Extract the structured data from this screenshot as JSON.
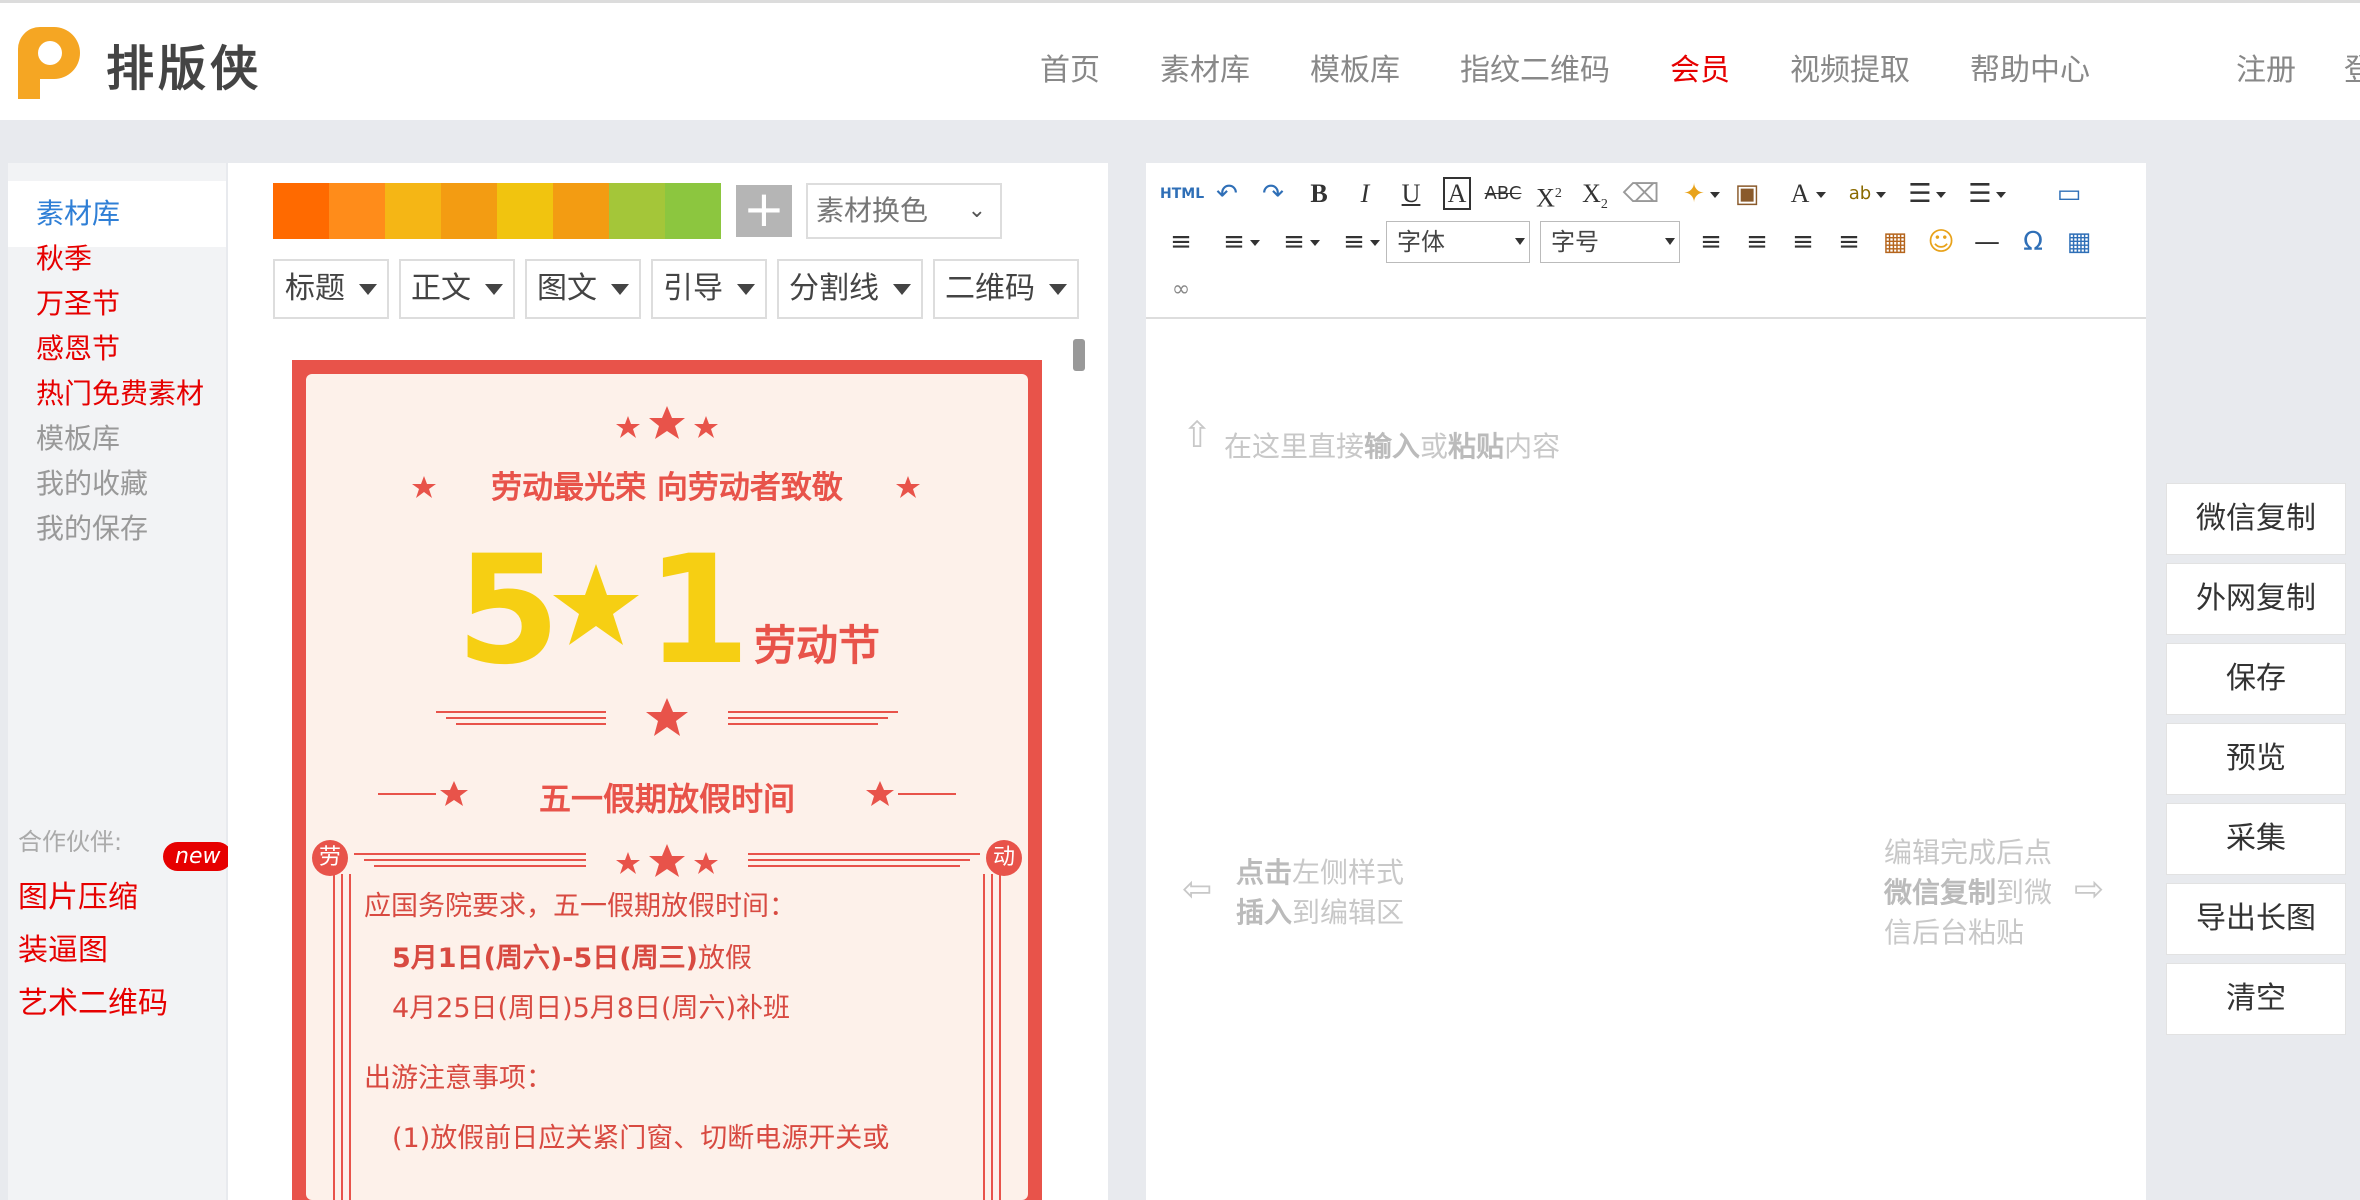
{
  "brand": {
    "name": "排版侠",
    "accent": "#f5a623"
  },
  "nav": {
    "items": [
      "首页",
      "素材库",
      "模板库",
      "指纹二维码",
      "会员",
      "视频提取",
      "帮助中心"
    ],
    "active_index": 4,
    "register": "注册",
    "login_partial": "登"
  },
  "sidebar": {
    "items": [
      {
        "label": "素材库",
        "state": "selected"
      },
      {
        "label": "秋季",
        "state": "red"
      },
      {
        "label": "万圣节",
        "state": "red"
      },
      {
        "label": "感恩节",
        "state": "red"
      },
      {
        "label": "热门免费素材",
        "state": "red"
      },
      {
        "label": "模板库",
        "state": "gray"
      },
      {
        "label": "我的收藏",
        "state": "gray"
      },
      {
        "label": "我的保存",
        "state": "gray"
      }
    ],
    "partner_label": "合作伙伴:",
    "new_badge": "new",
    "links": [
      "图片压缩",
      "装逼图",
      "艺术二维码"
    ]
  },
  "materials": {
    "swatch_colors": [
      "#ff6a00",
      "#ff8c1a",
      "#f5b615",
      "#f39c12",
      "#f1c40f",
      "#f39c12",
      "#a4c639",
      "#8cc63f"
    ],
    "add_icon": "plus-icon",
    "color_select": "素材换色",
    "filters": [
      "标题",
      "正文",
      "图文",
      "引导",
      "分割线",
      "二维码"
    ]
  },
  "poster": {
    "headline": "劳动最光荣 向劳动者致敬",
    "big_left": "5",
    "big_right": "1",
    "festival": "劳动节",
    "section": "五一假期放假时间",
    "badge_left": "劳",
    "badge_right": "动",
    "line1": "应国务院要求，五一假期放假时间：",
    "line2_bold": "5月1日(周六)-5日(周三)",
    "line2_rest": "放假",
    "line3": "4月25日(周日)5月8日(周六)补班",
    "line4": "出游注意事项：",
    "line5": "(1)放假前日应关紧门窗、切断电源开关或"
  },
  "editor": {
    "toolbar_icons": [
      "html-icon",
      "undo-icon",
      "redo-icon",
      "bold-icon",
      "italic-icon",
      "underline-icon",
      "font-border-icon",
      "strikethrough-icon",
      "superscript-icon",
      "subscript-icon",
      "eraser-icon",
      "magic-wand-icon",
      "paste-text-icon",
      "font-color-icon",
      "highlight-icon",
      "ordered-list-icon",
      "unordered-list-icon",
      "fullscreen-icon"
    ],
    "font_select": "字体",
    "size_select": "字号",
    "placeholder_pre": "在这里直接",
    "placeholder_b1": "输入",
    "placeholder_mid": "或",
    "placeholder_b2": "粘贴",
    "placeholder_post": "内容",
    "left_hint_b": "点击",
    "left_hint_1": "左侧样式",
    "left_hint_b2": "插入",
    "left_hint_2": "到编辑区",
    "right_hint_1": "编辑完成后点",
    "right_hint_b": "微信复制",
    "right_hint_2": "到微",
    "right_hint_3": "信后台粘贴"
  },
  "actions": [
    "微信复制",
    "外网复制",
    "保存",
    "预览",
    "采集",
    "导出长图",
    "清空"
  ]
}
